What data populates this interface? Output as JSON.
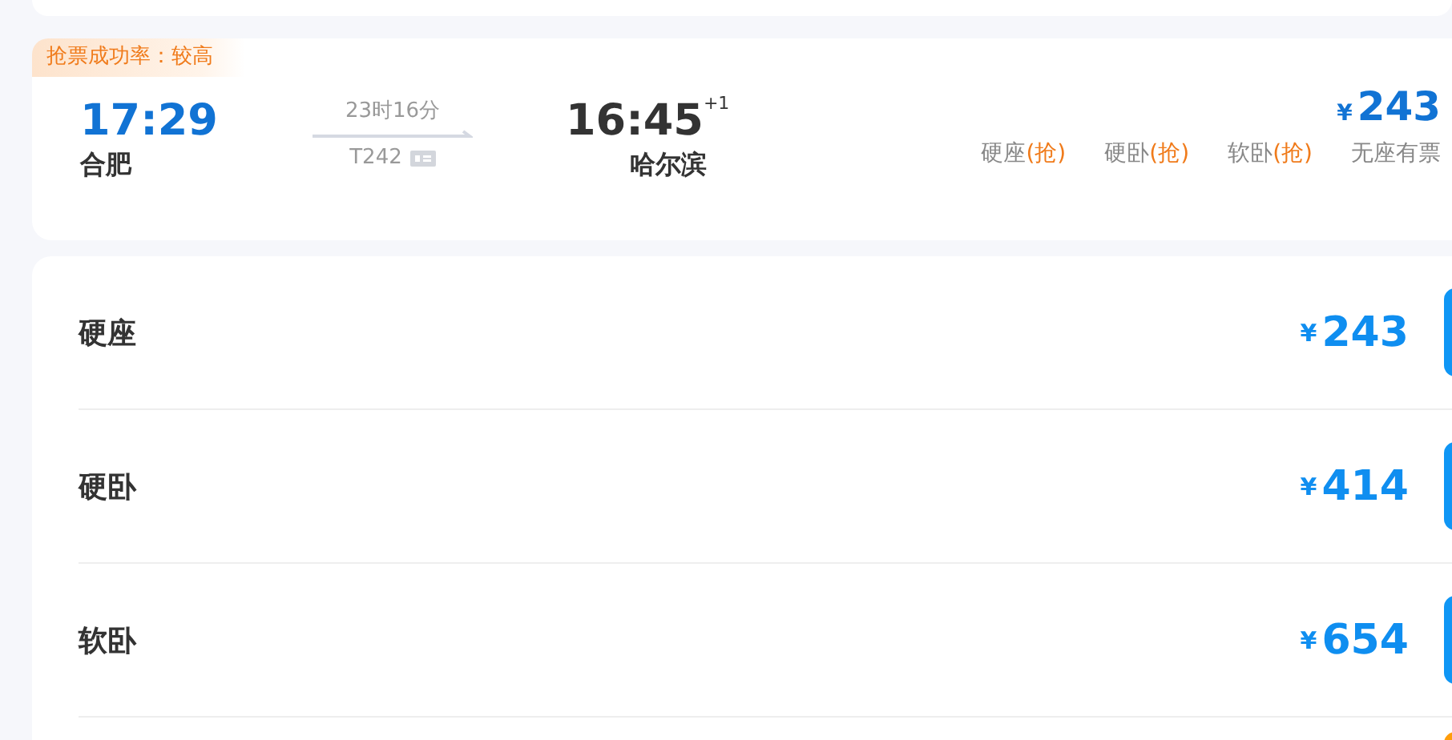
{
  "train": {
    "success_rate": "抢票成功率：较高",
    "depart_time": "17:29",
    "depart_station": "合肥",
    "duration": "23时16分",
    "train_no": "T242",
    "arrive_time": "16:45",
    "day_offset": "+1",
    "arrive_station": "哈尔滨",
    "currency": "¥",
    "price": "243",
    "seats": [
      {
        "name": "硬座",
        "grab": "(抢)"
      },
      {
        "name": "硬卧",
        "grab": "(抢)"
      },
      {
        "name": "软卧",
        "grab": "(抢)"
      },
      {
        "name": "无座有票"
      }
    ]
  },
  "seat_rows": [
    {
      "name": "硬座",
      "currency": "¥",
      "price": "243",
      "color": "#0f96f5"
    },
    {
      "name": "硬卧",
      "currency": "¥",
      "price": "414",
      "color": "#0f96f5"
    },
    {
      "name": "软卧",
      "currency": "¥",
      "price": "654",
      "color": "#0f96f5"
    },
    {
      "color": "#ff9d0a"
    }
  ]
}
